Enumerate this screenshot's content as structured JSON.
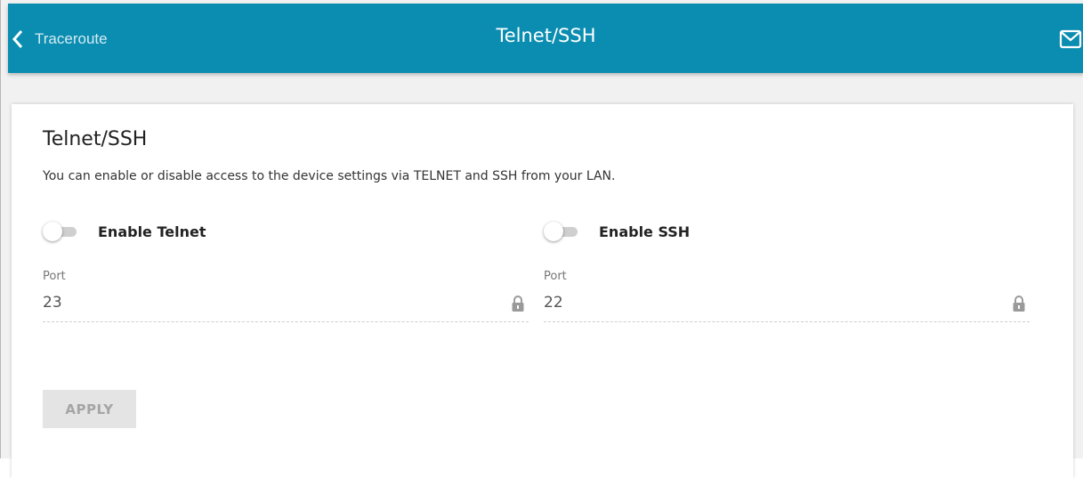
{
  "header": {
    "back_label": "Traceroute",
    "title": "Telnet/SSH",
    "mail_icon": "mail-icon",
    "colors": {
      "bar": "#0a8db0",
      "text": "#ffffff"
    }
  },
  "card": {
    "title": "Telnet/SSH",
    "description": "You can enable or disable access to the device settings via TELNET and SSH from your LAN."
  },
  "telnet": {
    "toggle_label": "Enable Telnet",
    "enabled": false,
    "port_label": "Port",
    "port_value": "23",
    "lock_icon": "lock-icon"
  },
  "ssh": {
    "toggle_label": "Enable SSH",
    "enabled": false,
    "port_label": "Port",
    "port_value": "22",
    "lock_icon": "lock-icon"
  },
  "actions": {
    "apply_label": "APPLY",
    "apply_disabled": true
  }
}
